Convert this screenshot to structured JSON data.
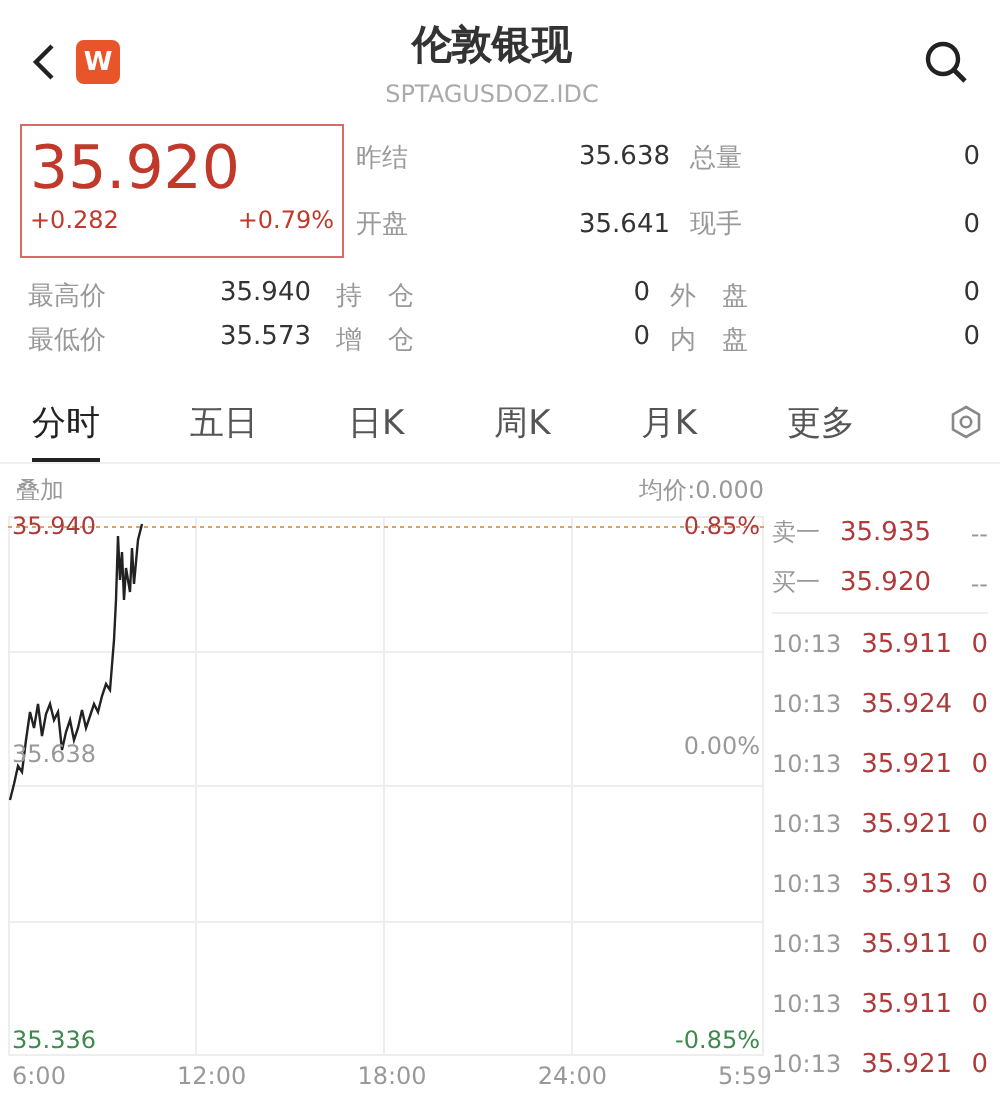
{
  "header": {
    "badge": "W",
    "title": "伦敦银现",
    "code": "SPTAGUSDOZ.IDC"
  },
  "quote": {
    "price": "35.920",
    "change": "+0.282",
    "change_pct": "+0.79%"
  },
  "stats_top": [
    {
      "label": "昨结",
      "value": "35.638"
    },
    {
      "label": "总量",
      "value": "0"
    },
    {
      "label": "开盘",
      "value": "35.641"
    },
    {
      "label": "现手",
      "value": "0"
    }
  ],
  "stats_bottom": [
    {
      "label": "最高价",
      "value": "35.940"
    },
    {
      "label": "持　仓",
      "value": "0"
    },
    {
      "label": "外　盘",
      "value": "0"
    },
    {
      "label": "最低价",
      "value": "35.573"
    },
    {
      "label": "增　仓",
      "value": "0"
    },
    {
      "label": "内　盘",
      "value": "0"
    }
  ],
  "tabs": [
    {
      "label": "分时",
      "selected": true
    },
    {
      "label": "五日",
      "selected": false
    },
    {
      "label": "日K",
      "selected": false
    },
    {
      "label": "周K",
      "selected": false
    },
    {
      "label": "月K",
      "selected": false
    },
    {
      "label": "更多",
      "selected": false
    }
  ],
  "chart": {
    "overlay": "叠加",
    "avg": "均价:0.000",
    "y_high": "35.940",
    "y_mid": "35.638",
    "y_low": "35.336",
    "pct_high": "0.85%",
    "pct_mid": "0.00%",
    "pct_low": "-0.85%",
    "x_labels": [
      "6:00",
      "12:00",
      "18:00",
      "24:00",
      "5:59"
    ]
  },
  "order_book": [
    {
      "label": "卖一",
      "price": "35.935",
      "volume": "--"
    },
    {
      "label": "买一",
      "price": "35.920",
      "volume": "--"
    }
  ],
  "trades": [
    {
      "time": "10:13",
      "price": "35.911",
      "volume": "0"
    },
    {
      "time": "10:13",
      "price": "35.924",
      "volume": "0"
    },
    {
      "time": "10:13",
      "price": "35.921",
      "volume": "0"
    },
    {
      "time": "10:13",
      "price": "35.921",
      "volume": "0"
    },
    {
      "time": "10:13",
      "price": "35.913",
      "volume": "0"
    },
    {
      "time": "10:13",
      "price": "35.911",
      "volume": "0"
    },
    {
      "time": "10:13",
      "price": "35.911",
      "volume": "0"
    },
    {
      "time": "10:13",
      "price": "35.921",
      "volume": "0"
    }
  ]
}
